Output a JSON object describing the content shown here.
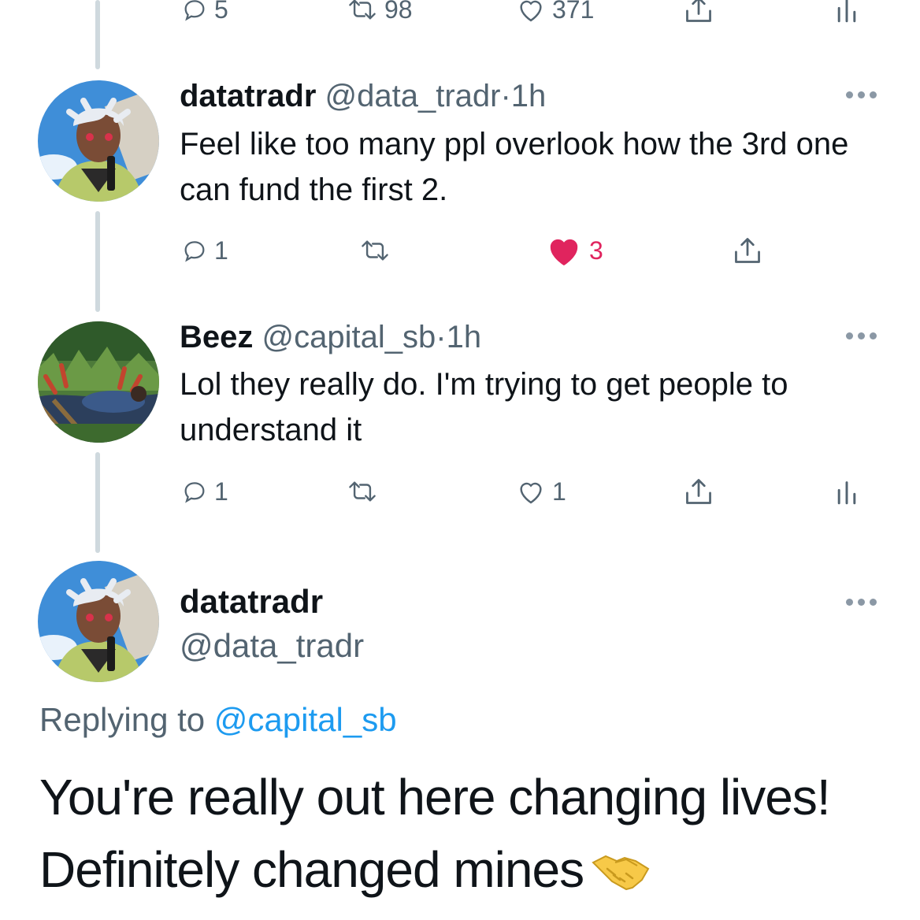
{
  "top_tweet_actions": {
    "replies": "5",
    "retweets": "98",
    "likes": "371"
  },
  "tweets": [
    {
      "name": "datatradr",
      "handle": "@data_tradr",
      "separator": "·",
      "time": "1h",
      "text": "Feel like too many ppl overlook how the 3rd one can fund the first 2.",
      "replies": "1",
      "retweets": "",
      "likes": "3",
      "liked": true
    },
    {
      "name": "Beez",
      "handle": "@capital_sb",
      "separator": "·",
      "time": "1h",
      "text": "Lol they really do. I'm trying to get people to understand it",
      "replies": "1",
      "retweets": "",
      "likes": "1",
      "liked": false
    }
  ],
  "focused_tweet": {
    "name": "datatradr",
    "handle": "@data_tradr",
    "replying_prefix": "Replying to",
    "replying_to": "@capital_sb",
    "text": "You're really out here changing lives! Definitely changed mines",
    "emoji": "handshake-emoji"
  },
  "colors": {
    "accent": "#1d9bf0",
    "like": "#e0245e",
    "muted": "#536471",
    "thread_line": "#cfd9de"
  },
  "icons": [
    "reply-icon",
    "retweet-icon",
    "like-icon",
    "share-icon",
    "analytics-icon",
    "more-icon"
  ]
}
